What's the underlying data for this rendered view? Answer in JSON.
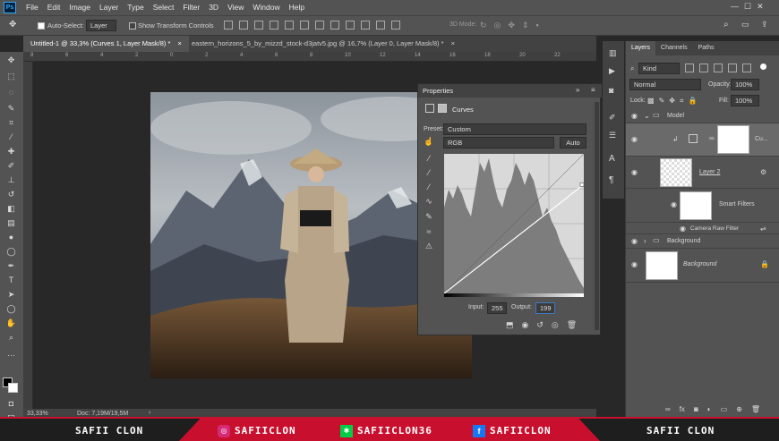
{
  "menu": [
    "File",
    "Edit",
    "Image",
    "Layer",
    "Type",
    "Select",
    "Filter",
    "3D",
    "View",
    "Window",
    "Help"
  ],
  "app_logo": "Ps",
  "options": {
    "auto_select_label": "Auto-Select:",
    "auto_select_value": "Layer",
    "transform_label": "Show Transform Controls",
    "mode_3d": "3D Mode:"
  },
  "tabs": [
    {
      "label": "Untitled-1 @ 33,3% (Curves 1, Layer Mask/8) *",
      "close": "×"
    },
    {
      "label": "eastern_horizons_5_by_mizzd_stock-d3jatv5.jpg @ 16,7% (Layer 0, Layer Mask/8) *",
      "close": "×"
    }
  ],
  "ruler_numbers": [
    "8",
    "6",
    "4",
    "2",
    "0",
    "2",
    "4",
    "6",
    "8",
    "10",
    "12",
    "14",
    "16",
    "18",
    "20",
    "22"
  ],
  "properties": {
    "panel_title": "Properties",
    "adjustment_name": "Curves",
    "preset_label": "Preset:",
    "preset_value": "Custom",
    "channel_value": "RGB",
    "auto_button": "Auto",
    "input_label": "Input:",
    "input_value": "255",
    "output_label": "Output:",
    "output_value": "199"
  },
  "status": {
    "zoom": "33,33%",
    "doc": "Doc: 7,19M/19,5M"
  },
  "layers_panel": {
    "tabs": [
      "Layers",
      "Channels",
      "Paths"
    ],
    "filter_kind": "Kind",
    "blend_mode": "Normal",
    "opacity_label": "Opacity:",
    "opacity_value": "100%",
    "lock_label": "Lock:",
    "fill_label": "Fill:",
    "fill_value": "100%",
    "layers": [
      {
        "name": "Model",
        "type": "group"
      },
      {
        "name": "Cu...",
        "type": "adjustment"
      },
      {
        "name": "Layer 2",
        "type": "smart"
      },
      {
        "name": "Smart Filters",
        "type": "filter-mask"
      },
      {
        "name": "Camera Raw Filter",
        "type": "filter"
      },
      {
        "name": "Background",
        "type": "group"
      },
      {
        "name": "Background",
        "type": "background"
      }
    ]
  },
  "banner": {
    "left_name": "SAFII CLON",
    "instagram": "SAFIICLON",
    "deviantart": "SAFIICLON36",
    "facebook": "SAFIICLON",
    "right_name": "SAFII CLON"
  },
  "curve_points": [
    [
      0,
      0
    ],
    [
      255,
      199
    ]
  ]
}
